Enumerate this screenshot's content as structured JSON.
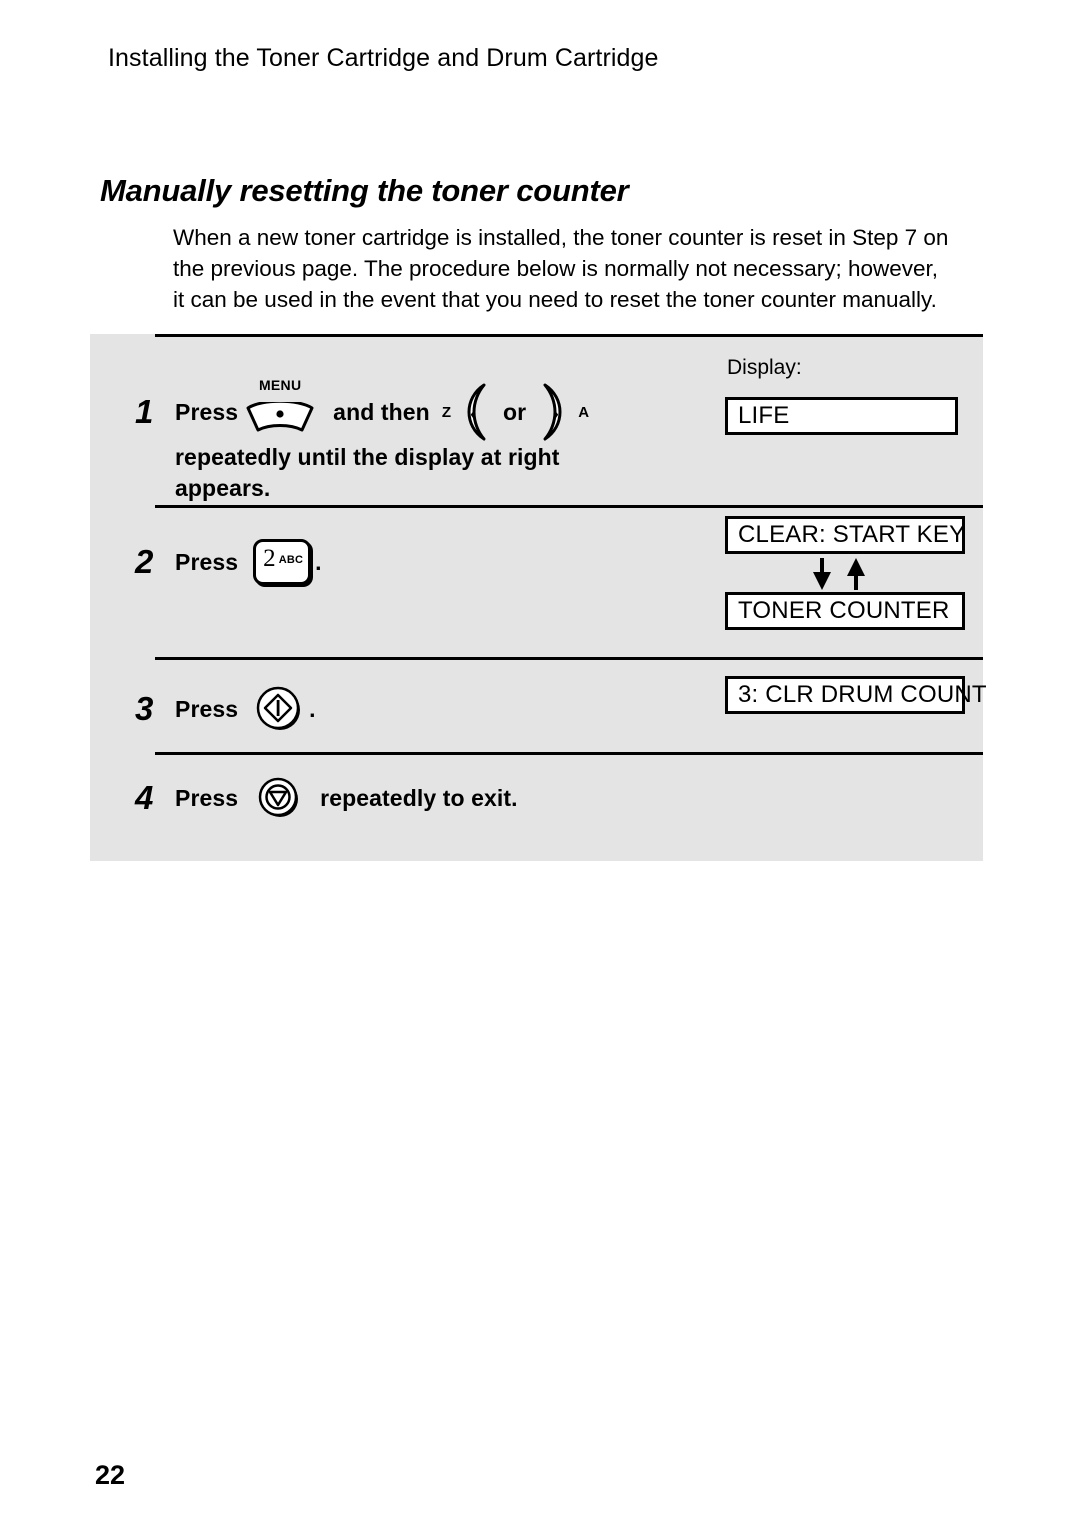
{
  "header": {
    "running_title": "Installing the Toner Cartridge and Drum Cartridge"
  },
  "section": {
    "title": "Manually resetting the toner counter"
  },
  "intro": {
    "line1": "When a new toner cartridge is installed, the toner counter is reset in Step 7 on",
    "line2": "the previous page. The procedure below is normally not necessary; however,",
    "line3": "it can be used in the event that you need to reset the toner counter manually."
  },
  "procedure": {
    "display_column_label": "Display:",
    "steps": [
      {
        "number": "1",
        "press_label": "Press",
        "menu_key_label": "MENU",
        "connector": "and then",
        "left_arrow_label": "Z",
        "left_arrow_glyph": "‹",
        "or_label": "or",
        "right_arrow_glyph": "›",
        "right_arrow_label": "A",
        "continuation_line1": "repeatedly until the display at right",
        "continuation_line2": "appears.",
        "displays": [
          "LIFE"
        ]
      },
      {
        "number": "2",
        "press_label": "Press",
        "key_digit": "2",
        "key_letters": "ABC",
        "trailing": ".",
        "displays": [
          "CLEAR: START KEY",
          "TONER COUNTER"
        ]
      },
      {
        "number": "3",
        "press_label": "Press",
        "key_name": "start-key",
        "trailing": ".",
        "displays": [
          "3: CLR DRUM COUNT"
        ]
      },
      {
        "number": "4",
        "press_label": "Press",
        "key_name": "stop-key",
        "suffix": "repeatedly to exit.",
        "displays": []
      }
    ]
  },
  "footer": {
    "page_number": "22"
  },
  "colors": {
    "panel_background": "#e4e4e4",
    "rule": "#000000",
    "display_background": "#ffffff",
    "text": "#000000"
  }
}
